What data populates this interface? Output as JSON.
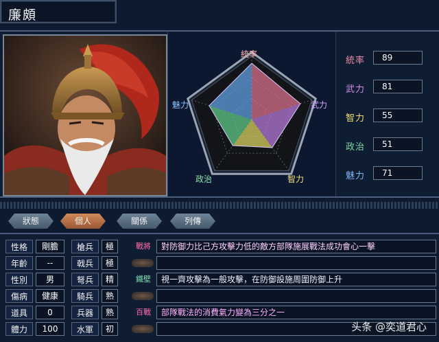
{
  "title": "廉頗",
  "radar": {
    "labels": {
      "top": "統率",
      "right": "武力",
      "bottom_right": "智力",
      "bottom_left": "政治",
      "left": "魅力"
    },
    "values": {
      "統率": 89,
      "武力": 81,
      "智力": 55,
      "政治": 51,
      "魅力": 71
    },
    "max": 100
  },
  "stats": [
    {
      "label": "統率",
      "value": "89",
      "color": "#e88fa8"
    },
    {
      "label": "武力",
      "value": "81",
      "color": "#d68ee8"
    },
    {
      "label": "智力",
      "value": "55",
      "color": "#f0e070"
    },
    {
      "label": "政治",
      "value": "51",
      "color": "#7ed9a0"
    },
    {
      "label": "魅力",
      "value": "71",
      "color": "#82b3f0"
    }
  ],
  "tabs": [
    "狀態",
    "個人",
    "關係",
    "列傳"
  ],
  "active_tab": "個人",
  "attributes": {
    "personality": {
      "label": "性格",
      "value": "剛膽"
    },
    "age": {
      "label": "年齡",
      "value": "--"
    },
    "gender": {
      "label": "性別",
      "value": "男"
    },
    "injury": {
      "label": "傷病",
      "value": "健康"
    },
    "item": {
      "label": "道具",
      "value": "0"
    },
    "strength": {
      "label": "體力",
      "value": "100"
    }
  },
  "aptitudes": [
    {
      "label": "槍兵",
      "value": "極"
    },
    {
      "label": "戟兵",
      "value": "極"
    },
    {
      "label": "弩兵",
      "value": "精"
    },
    {
      "label": "騎兵",
      "value": "熟"
    },
    {
      "label": "兵器",
      "value": "熟"
    },
    {
      "label": "水軍",
      "value": "初"
    }
  ],
  "skills": [
    {
      "name": "戰將",
      "desc": "對防御力比己方攻擊力低的敵方部隊施展戰法成功會心一擊",
      "color": "#ff6aa8"
    },
    {
      "name": "",
      "desc": "",
      "color": ""
    },
    {
      "name": "鐵壁",
      "desc": "視一齊攻擊為一般攻擊，在防御設施周圍防御上升",
      "color": "#7ee0b0"
    },
    {
      "name": "",
      "desc": "",
      "color": ""
    },
    {
      "name": "百戰",
      "desc": "部隊戰法的消費氣力變為三分之一",
      "color": "#ff6aa8"
    },
    {
      "name": "",
      "desc": "",
      "color": ""
    }
  ],
  "watermark": "头条 @奕道君心",
  "colors": {
    "background": "#0d1a30",
    "panel": "#0f1d33",
    "border": "#6d7b8f",
    "tab_active": "#b86c3e",
    "tab_inactive": "#5a6e83"
  }
}
